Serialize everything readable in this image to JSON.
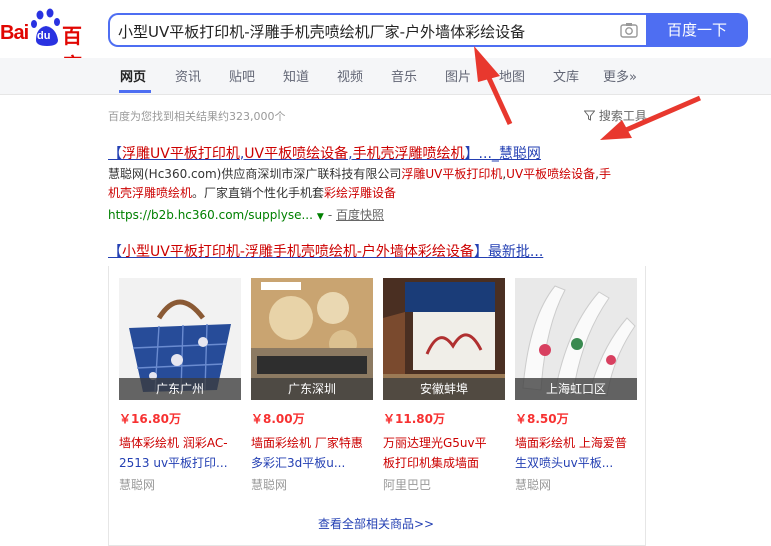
{
  "logo": {
    "bai": "Bai",
    "du": "du",
    "cn": "百度"
  },
  "search": {
    "query": "小型UV平板打印机-浮雕手机壳喷绘机厂家-户外墙体彩绘设备",
    "button": "百度一下"
  },
  "tabs": [
    "网页",
    "资讯",
    "贴吧",
    "知道",
    "视频",
    "音乐",
    "图片",
    "地图",
    "文库",
    "更多»"
  ],
  "result_count": "百度为您找到相关结果约323,000个",
  "search_tools": "搜索工具",
  "result1": {
    "title_parts": [
      "【",
      "浮雕UV平板打印机",
      ",",
      "UV平板",
      "喷绘设备",
      ",",
      "手机壳浮雕喷绘机",
      "】...",
      "_慧聪网"
    ],
    "desc_line1_parts": [
      "慧聪网(Hc360.com)供应商深圳市深广联科技有限公司",
      "浮雕UV平板打印机",
      ",",
      "UV平板喷绘设备",
      ",",
      "手"
    ],
    "desc_line2_parts": [
      "机壳浮雕喷绘机",
      "。厂家直销个性化手机套",
      "彩绘浮雕设备"
    ],
    "url": "https://b2b.hc360.com/supplyse...",
    "snapshot": "百度快照"
  },
  "result2": {
    "title_parts": [
      "【",
      "小型UV平板打印机-浮雕手机壳喷绘机-户外墙体彩绘设备",
      "】",
      "最新批..."
    ]
  },
  "products": [
    {
      "location": "广东广州",
      "price": "￥16.80万",
      "title_line1": "墙体彩绘机 润彩AC-",
      "title_line2": "2513 uv平板打印...",
      "source": "慧聪网"
    },
    {
      "location": "广东深圳",
      "price": "￥8.00万",
      "title_line1": "墙面彩绘机 厂家特惠",
      "title_line2": "多彩汇3d平板u...",
      "source": "慧聪网"
    },
    {
      "location": "安徽蚌埠",
      "price": "￥11.80万",
      "title_line1": "万丽达理光G5uv平",
      "title_line2": "板打印机集成墙面",
      "source": "阿里巴巴"
    },
    {
      "location": "上海虹口区",
      "price": "￥8.50万",
      "title_line1": "墙面彩绘机 上海爱普",
      "title_line2": "生双喷头uv平板...",
      "source": "慧聪网"
    }
  ],
  "view_all": "查看全部相关商品>>",
  "colors": {
    "brand": "#4e6ef2",
    "link": "#2440b3",
    "highlight": "#c00",
    "price": "#f73131",
    "url": "#008000",
    "annotation_arrow": "#e8382e"
  }
}
